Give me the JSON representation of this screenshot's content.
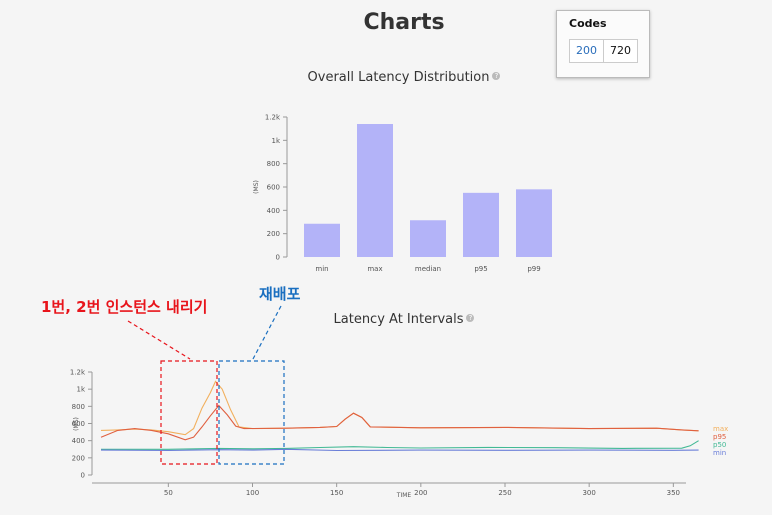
{
  "page": {
    "title": "Charts"
  },
  "codes": {
    "title": "Codes",
    "items": [
      {
        "code": "200",
        "count": "720"
      }
    ],
    "code_color": "#2a6ebb"
  },
  "annotations": {
    "left": {
      "text": "1번, 2번 인스턴스 내리기",
      "color": "#e8141b"
    },
    "right": {
      "text": "재배포",
      "color": "#1a6fc0"
    }
  },
  "chart_data": [
    {
      "type": "bar",
      "title": "Overall Latency Distribution",
      "ylabel": "(MS)",
      "categories": [
        "min",
        "max",
        "median",
        "p95",
        "p99"
      ],
      "values": [
        285,
        1140,
        315,
        550,
        580
      ],
      "ylim": [
        0,
        1200
      ],
      "yticks": [
        0,
        200,
        400,
        600,
        800,
        1000,
        1200
      ],
      "ytick_labels": [
        "0",
        "200",
        "400",
        "600",
        "800",
        "1k",
        "1.2k"
      ],
      "bar_color": "#b3b3f8",
      "grid": false
    },
    {
      "type": "line",
      "title": "Latency At Intervals",
      "xlabel": "TIME",
      "ylabel": "(MS)",
      "xlim": [
        10,
        370
      ],
      "ylim": [
        0,
        1200
      ],
      "xticks": [
        50,
        100,
        150,
        200,
        250,
        300,
        350
      ],
      "yticks": [
        0,
        200,
        400,
        600,
        800,
        1000,
        1200
      ],
      "ytick_labels": [
        "0",
        "200",
        "400",
        "600",
        "800",
        "1k",
        "1.2k"
      ],
      "legend_position": "right",
      "series": [
        {
          "name": "max",
          "color": "#f2b05e",
          "points": [
            [
              10,
              520
            ],
            [
              20,
              525
            ],
            [
              30,
              535
            ],
            [
              40,
              525
            ],
            [
              50,
              505
            ],
            [
              60,
              470
            ],
            [
              65,
              540
            ],
            [
              70,
              780
            ],
            [
              75,
              960
            ],
            [
              78,
              1090
            ],
            [
              82,
              1000
            ],
            [
              87,
              760
            ],
            [
              92,
              560
            ],
            [
              100,
              540
            ],
            [
              120,
              545
            ],
            [
              140,
              555
            ],
            [
              150,
              565
            ],
            [
              155,
              650
            ],
            [
              160,
              720
            ],
            [
              165,
              670
            ],
            [
              170,
              560
            ],
            [
              200,
              550
            ],
            [
              250,
              555
            ],
            [
              300,
              540
            ],
            [
              340,
              545
            ],
            [
              355,
              525
            ],
            [
              365,
              515
            ]
          ]
        },
        {
          "name": "p95",
          "color": "#e06040",
          "points": [
            [
              10,
              440
            ],
            [
              20,
              520
            ],
            [
              30,
              540
            ],
            [
              40,
              520
            ],
            [
              50,
              480
            ],
            [
              60,
              410
            ],
            [
              65,
              440
            ],
            [
              70,
              560
            ],
            [
              75,
              690
            ],
            [
              80,
              810
            ],
            [
              85,
              700
            ],
            [
              90,
              570
            ],
            [
              95,
              540
            ],
            [
              120,
              545
            ],
            [
              140,
              555
            ],
            [
              150,
              565
            ],
            [
              155,
              650
            ],
            [
              160,
              720
            ],
            [
              165,
              670
            ],
            [
              170,
              560
            ],
            [
              200,
              550
            ],
            [
              250,
              555
            ],
            [
              300,
              540
            ],
            [
              340,
              545
            ],
            [
              355,
              525
            ],
            [
              365,
              515
            ]
          ]
        },
        {
          "name": "p50",
          "color": "#42b995",
          "points": [
            [
              10,
              300
            ],
            [
              50,
              300
            ],
            [
              80,
              310
            ],
            [
              100,
              305
            ],
            [
              120,
              310
            ],
            [
              140,
              320
            ],
            [
              160,
              330
            ],
            [
              180,
              320
            ],
            [
              200,
              315
            ],
            [
              240,
              322
            ],
            [
              280,
              318
            ],
            [
              320,
              310
            ],
            [
              355,
              312
            ],
            [
              360,
              340
            ],
            [
              365,
              400
            ]
          ]
        },
        {
          "name": "min",
          "color": "#6b7fd8",
          "points": [
            [
              10,
              290
            ],
            [
              50,
              285
            ],
            [
              80,
              295
            ],
            [
              100,
              290
            ],
            [
              120,
              300
            ],
            [
              150,
              285
            ],
            [
              200,
              290
            ],
            [
              250,
              288
            ],
            [
              300,
              290
            ],
            [
              350,
              288
            ],
            [
              365,
              290
            ]
          ]
        }
      ]
    }
  ]
}
